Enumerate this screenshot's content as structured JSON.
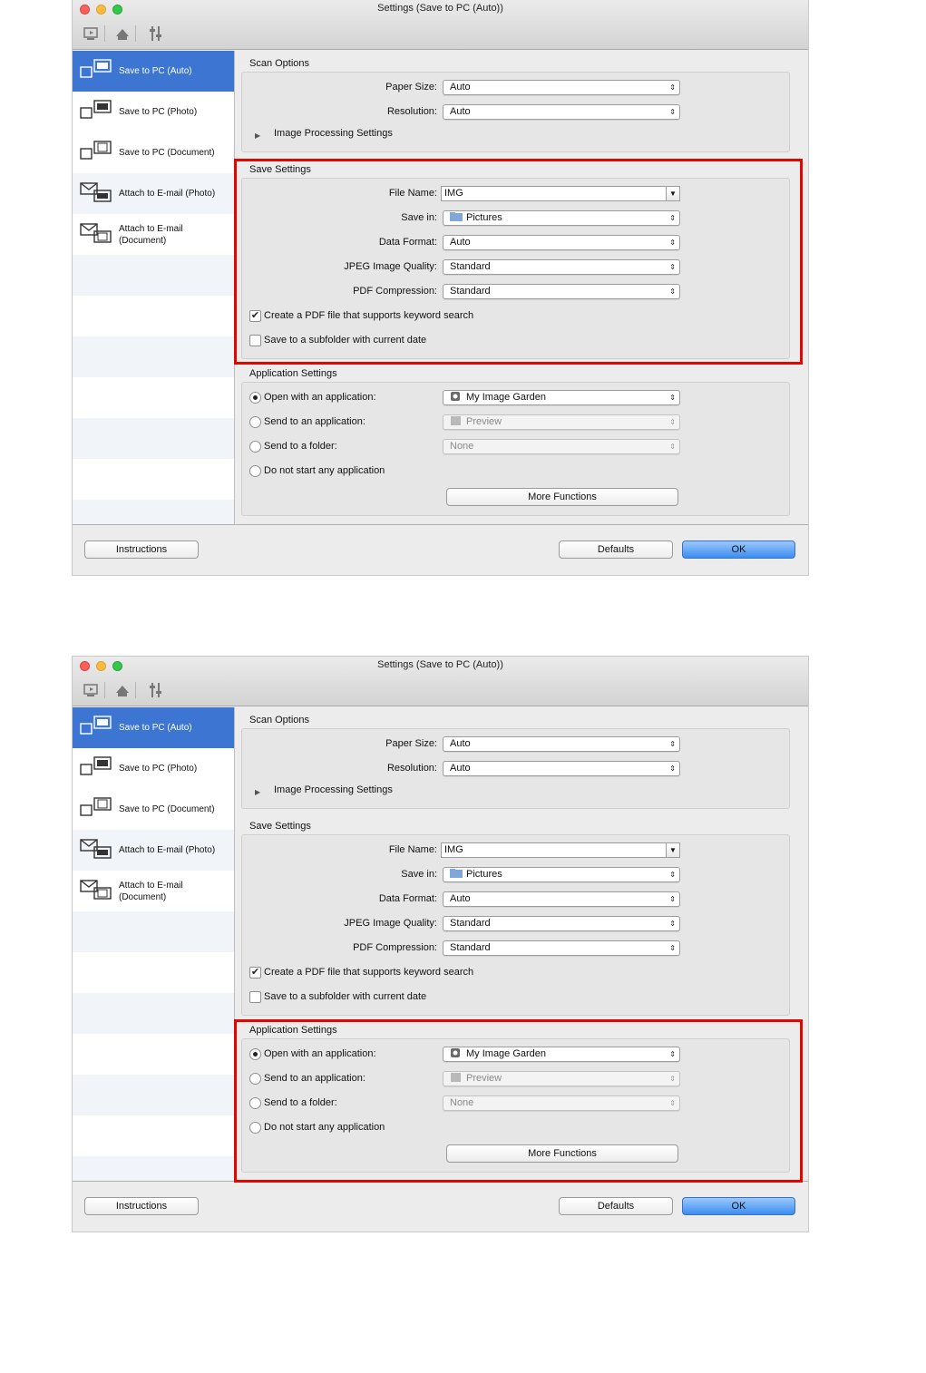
{
  "window_title": "Settings (Save to PC (Auto))",
  "sidebar": {
    "items": [
      {
        "label": "Save to PC (Auto)",
        "icon": "save-to-pc-auto-icon"
      },
      {
        "label": "Save to PC (Photo)",
        "icon": "save-to-pc-photo-icon"
      },
      {
        "label": "Save to PC (Document)",
        "icon": "save-to-pc-document-icon"
      },
      {
        "label": "Attach to E-mail (Photo)",
        "icon": "attach-email-photo-icon"
      },
      {
        "label": "Attach to E-mail\n(Document)",
        "icon": "attach-email-document-icon"
      }
    ]
  },
  "scan_options": {
    "title": "Scan Options",
    "paper_size_label": "Paper Size:",
    "paper_size_value": "Auto",
    "resolution_label": "Resolution:",
    "resolution_value": "Auto",
    "image_processing": "Image Processing Settings"
  },
  "save_settings": {
    "title": "Save Settings",
    "file_name_label": "File Name:",
    "file_name_value": "IMG",
    "save_in_label": "Save in:",
    "save_in_value": "Pictures",
    "data_format_label": "Data Format:",
    "data_format_value": "Auto",
    "jpeg_quality_label": "JPEG Image Quality:",
    "jpeg_quality_value": "Standard",
    "pdf_compression_label": "PDF Compression:",
    "pdf_compression_value": "Standard",
    "keyword_search_label": "Create a PDF file that supports keyword search",
    "keyword_search_checked": true,
    "subfolder_label": "Save to a subfolder with current date",
    "subfolder_checked": false
  },
  "application_settings": {
    "title": "Application Settings",
    "open_with_label": "Open with an application:",
    "open_with_value": "My Image Garden",
    "send_to_app_label": "Send to an application:",
    "send_to_app_value": "Preview",
    "send_to_folder_label": "Send to a folder:",
    "send_to_folder_value": "None",
    "do_not_start_label": "Do not start any application",
    "selected": "open_with",
    "more_functions": "More Functions"
  },
  "buttons": {
    "instructions": "Instructions",
    "defaults": "Defaults",
    "ok": "OK"
  },
  "highlight_color": "#e10600"
}
